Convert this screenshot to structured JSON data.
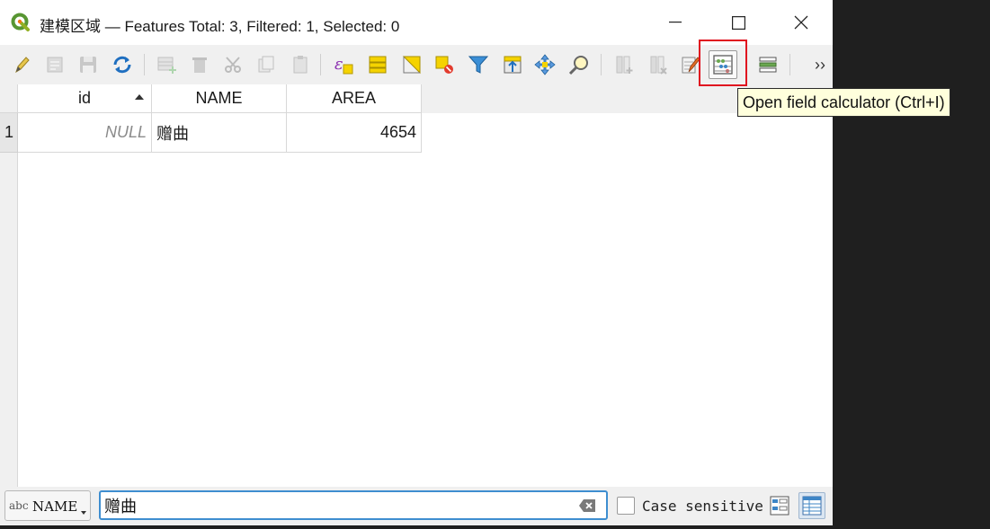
{
  "window": {
    "title": "建模区域 — Features Total: 3, Filtered: 1, Selected: 0"
  },
  "toolbar": {
    "more_label": "››"
  },
  "table": {
    "columns": [
      "id",
      "NAME",
      "AREA"
    ],
    "sorted_column": "id",
    "sort_direction": "ascending",
    "rows": [
      {
        "row_number": "1",
        "id": "NULL",
        "NAME": "赠曲",
        "AREA": "4654"
      }
    ]
  },
  "filter_bar": {
    "field_type": "abc",
    "field_name": "NAME",
    "search_value": "赠曲",
    "case_sensitive_label": "Case sensitive",
    "case_sensitive_checked": false
  },
  "tooltip": {
    "text": "Open field calculator (Ctrl+I)"
  },
  "colors": {
    "highlight": "#e0101f",
    "input_focus": "#3e8ed0",
    "tooltip_bg": "#ffffdc"
  }
}
